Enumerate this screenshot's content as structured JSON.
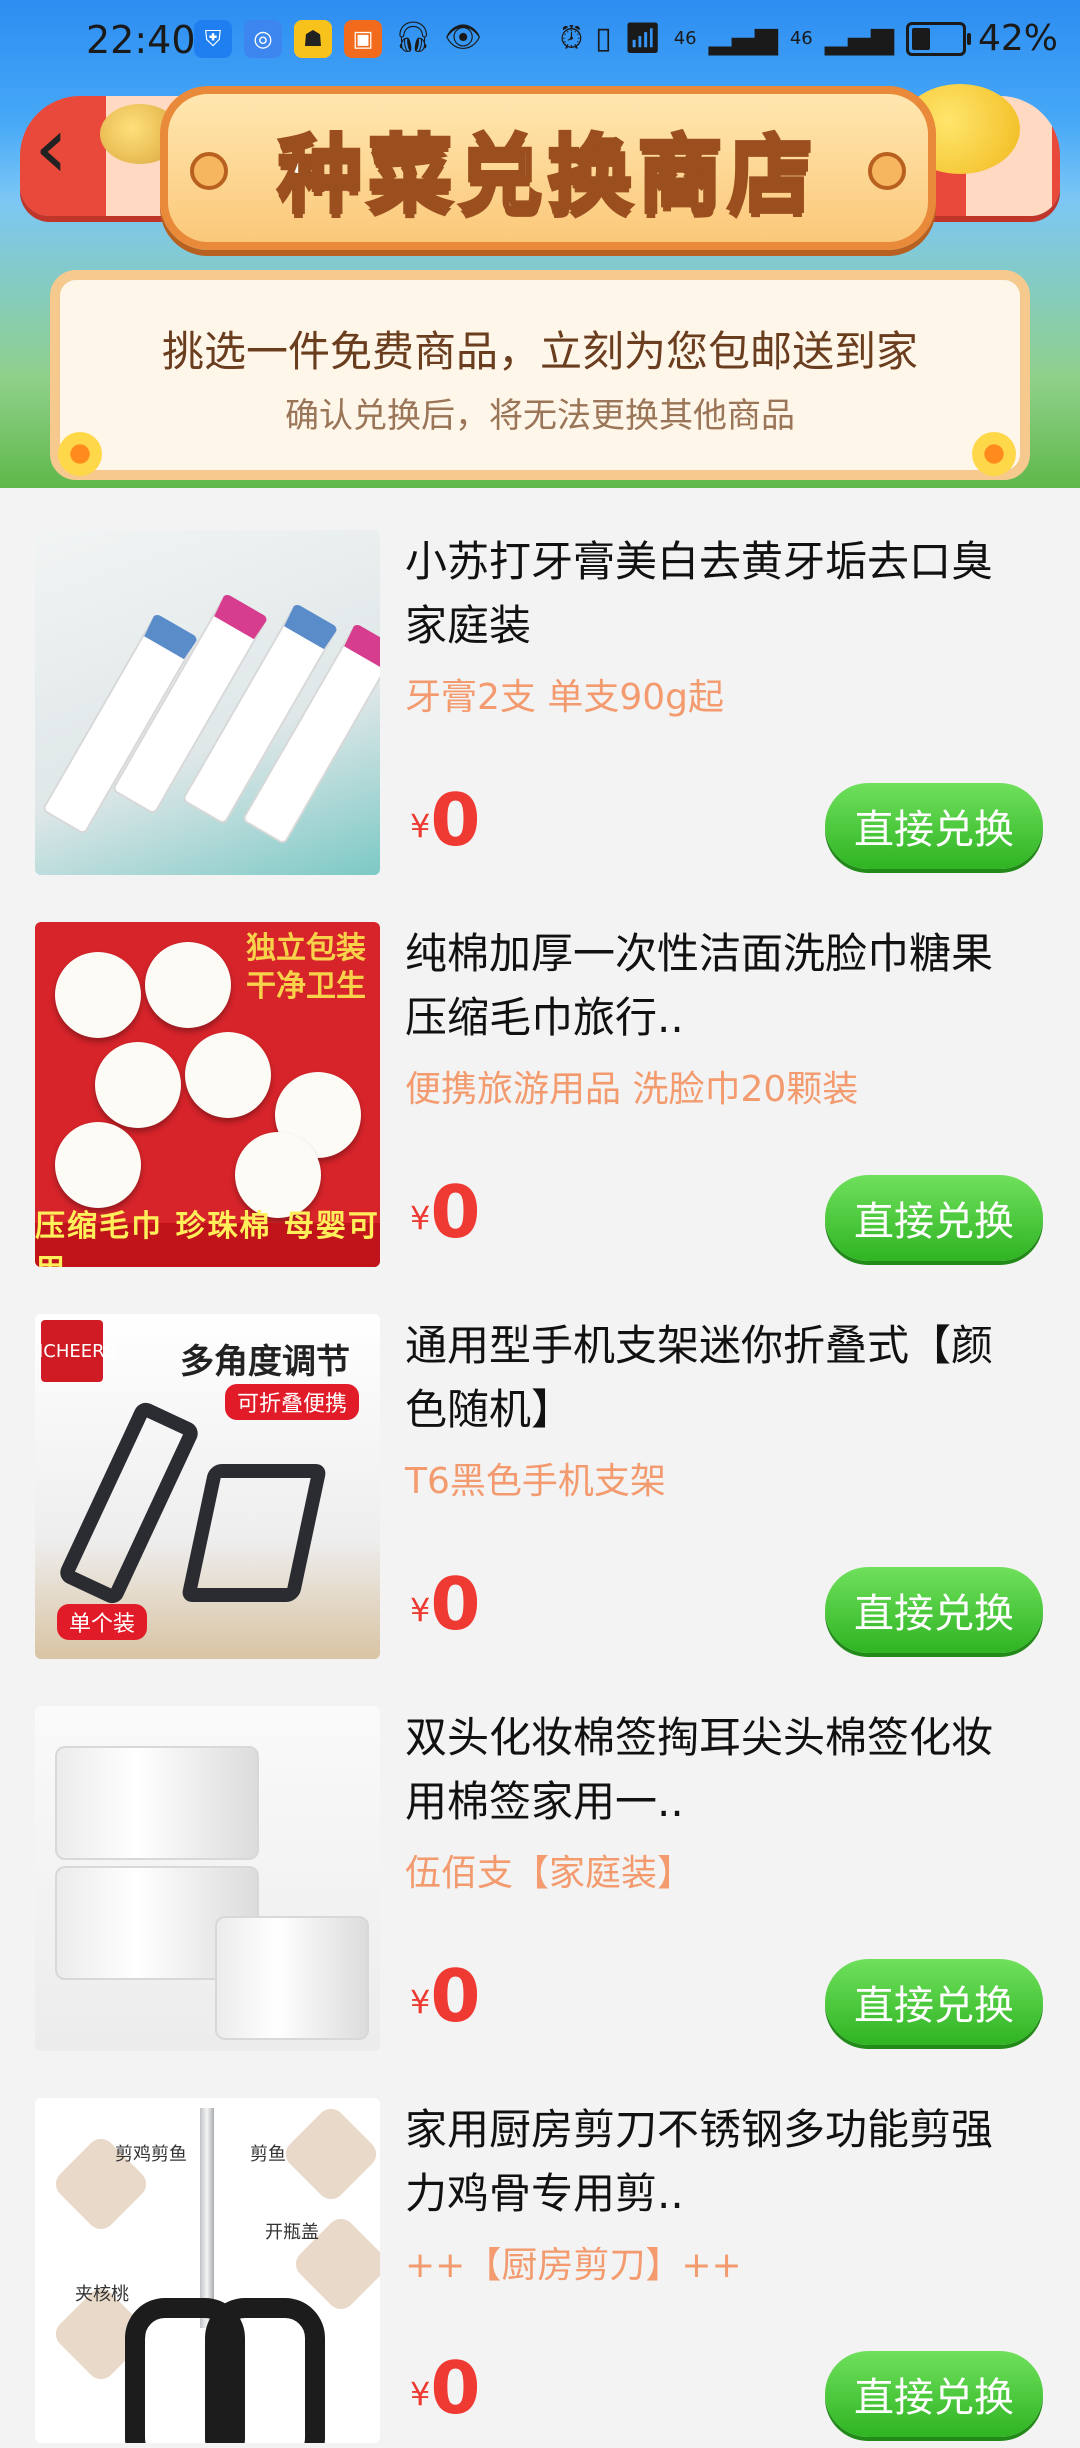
{
  "status_bar": {
    "time": "22:40",
    "battery": "42%",
    "network_1": "46",
    "network_2": "46",
    "battery_level": 0.42
  },
  "header": {
    "title": "种菜兑换商店",
    "notice_main": "挑选一件免费商品，立刻为您包邮送到家",
    "notice_sub": "确认兑换后，将无法更换其他商品"
  },
  "products": [
    {
      "title": "小苏打牙膏美白去黄牙垢去口臭家庭装",
      "spec": "牙膏2支 单支90g起",
      "price_symbol": "¥",
      "price": "0",
      "button": "直接兑换"
    },
    {
      "title": "纯棉加厚一次性洁面洗脸巾糖果压缩毛巾旅行..",
      "spec": "便携旅游用品 洗脸巾20颗装",
      "price_symbol": "¥",
      "price": "0",
      "button": "直接兑换",
      "image_text": {
        "tag_line1": "独立包装",
        "tag_line2": "干净卫生",
        "ribbon": "压缩毛巾 珍珠棉 母婴可用"
      }
    },
    {
      "title": "通用型手机支架迷你折叠式【颜色随机】",
      "spec": "T6黑色手机支架",
      "price_symbol": "¥",
      "price": "0",
      "button": "直接兑换",
      "image_text": {
        "logo": "LICHEERS",
        "headline": "多角度调节",
        "badge_top": "可折叠便携",
        "badge_bottom": "单个装"
      }
    },
    {
      "title": "双头化妆棉签掏耳尖头棉签化妆用棉签家用一..",
      "spec": "伍佰支【家庭装】",
      "price_symbol": "¥",
      "price": "0",
      "button": "直接兑换"
    },
    {
      "title": "家用厨房剪刀不锈钢多功能剪强力鸡骨专用剪..",
      "spec": "++【厨房剪刀】++",
      "price_symbol": "¥",
      "price": "0",
      "button": "直接兑换",
      "image_text": {
        "label_1": "剪鸡剪鱼",
        "label_2": "剪鱼",
        "label_3": "开瓶盖",
        "label_4": "夹核桃"
      }
    }
  ],
  "colors": {
    "price_red": "#ee3a32",
    "spec_orange": "#f39a6e",
    "button_green": "#3cbf2c",
    "page_bg": "#f3f3f3"
  }
}
